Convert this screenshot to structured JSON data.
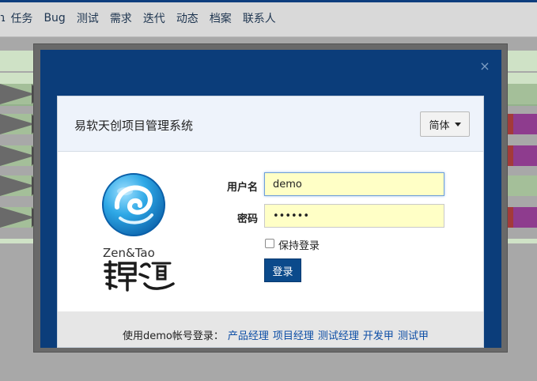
{
  "nav": {
    "edge_glyph": "ɿ",
    "items": [
      "任务",
      "Bug",
      "测试",
      "需求",
      "迭代",
      "动态",
      "档案",
      "联系人"
    ]
  },
  "dialog": {
    "close_glyph": "×",
    "title": "易软天创项目管理系统",
    "language_button": "简体",
    "brand_text": "Zen&Tao",
    "brand_calligraphy": "禪道",
    "fields": {
      "username_label": "用户名",
      "username_value": "demo",
      "password_label": "密码",
      "password_value": "••••••"
    },
    "remember_label": "保持登录",
    "login_button": "登录",
    "footer": {
      "prefix": "使用demo帐号登录：",
      "links": [
        "产品经理",
        "项目经理",
        "测试经理",
        "开发甲",
        "测试甲"
      ]
    }
  },
  "colors": {
    "modal_blue": "#0b3d7a",
    "input_bg": "#ffffc6",
    "login_button_bg": "#0b4a8b",
    "link": "#0d4ea6"
  }
}
